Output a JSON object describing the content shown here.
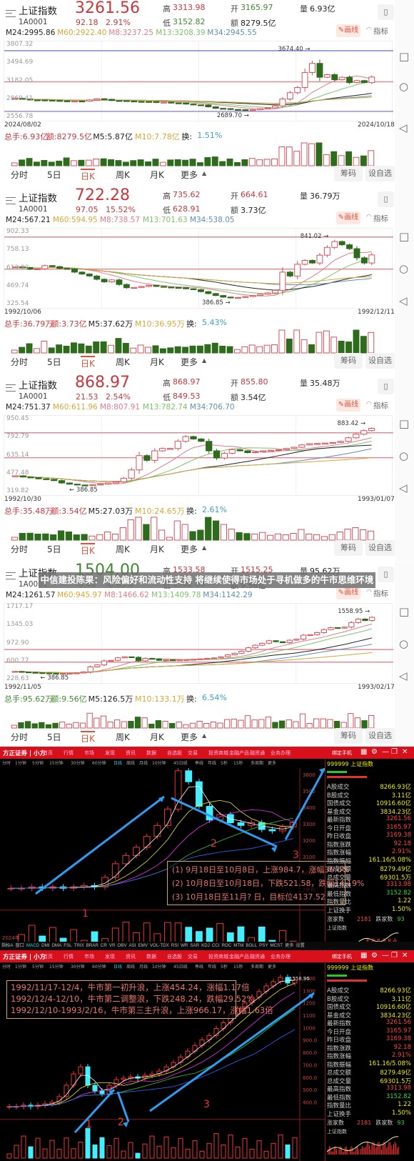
{
  "panels": [
    {
      "name": "上证指数",
      "code": "1A0001",
      "price": "3261.56",
      "change": "92.18",
      "change_pct": "2.91%",
      "price_color": "#c8373b",
      "high_label": "高",
      "high": "3313.98",
      "low_label": "低",
      "low": "3152.82",
      "open_label": "开",
      "open": "3165.97",
      "amount_label": "额",
      "amount": "8279.5亿",
      "vol_label": "量",
      "vol": "6.93亿",
      "ma": [
        "M24:2995.86",
        "M60:2922.40",
        "M8:3237.25",
        "M13:3208.39",
        "M34:2945.55"
      ],
      "axis": [
        "3807.32",
        "3494.69",
        "3182.05",
        "2869.41",
        "2556.78"
      ],
      "ylim": [
        2556.78,
        3807.32
      ],
      "date_start": "2024/08/02",
      "date_end": "2024/10/18",
      "vol_stats": [
        "总手:6.93亿",
        "额:8279.5亿",
        "M5:5.87亿",
        "M10:7.78亿",
        "换:",
        "1.51%"
      ],
      "high_mark": "3674.40",
      "low_mark": "2689.70",
      "high_val": 3674.4,
      "low_val": 2689.7,
      "hlines": [
        {
          "v": 3700,
          "c": "#7b86d6"
        },
        {
          "v": 3182,
          "c": "#e08a95"
        },
        {
          "v": 2689,
          "c": "#9b8ed6"
        }
      ],
      "closes": [
        2905,
        2893,
        2880,
        2879,
        2876,
        2870,
        2867,
        2850,
        2862,
        2858,
        2880,
        2900,
        2890,
        2870,
        2868,
        2862,
        2855,
        2853,
        2850,
        2837,
        2842,
        2830,
        2827,
        2811,
        2798,
        2796,
        2765,
        2740,
        2735,
        2721,
        2718,
        2704,
        2717,
        2736,
        2748,
        2780,
        2896,
        3000,
        3087,
        3336,
        3489,
        3258,
        3301,
        3217,
        3258,
        3169,
        3202,
        3169,
        3261
      ]
    },
    {
      "name": "上证指数",
      "code": "1A0001",
      "price": "722.28",
      "change": "97.05",
      "change_pct": "15.52%",
      "price_color": "#c8373b",
      "high_label": "高",
      "high": "735.62",
      "low_label": "低",
      "low": "628.91",
      "open_label": "开",
      "open": "664.61",
      "amount_label": "额",
      "amount": "3.73亿",
      "vol_label": "量",
      "vol": "36.79万",
      "ma": [
        "M24:567.21",
        "M60:594.95",
        "M8:738.57",
        "M13:701.63",
        "M34:538.05"
      ],
      "axis": [
        "902.33",
        "758.13",
        "613.93",
        "469.74",
        "325.54"
      ],
      "ylim": [
        325.54,
        902.33
      ],
      "date_start": "1992/10/06",
      "date_end": "1992/12/11",
      "vol_stats": [
        "总手:36.79万",
        "额:3.73亿",
        "M5:37.62万",
        "M10:36.95万",
        "换:",
        "5.43%"
      ],
      "high_mark": "841.02",
      "low_mark": "386.85",
      "high_val": 841.02,
      "low_val": 386.85,
      "hlines": [
        {
          "v": 860,
          "c": "#e08a95"
        },
        {
          "v": 613,
          "c": "#e08a95"
        }
      ],
      "closes": [
        630,
        625,
        612,
        615,
        640,
        632,
        618,
        614,
        590,
        575,
        560,
        535,
        515,
        530,
        495,
        470,
        472,
        480,
        488,
        480,
        475,
        472,
        470,
        462,
        455,
        440,
        425,
        410,
        398,
        393,
        395,
        402,
        410,
        420,
        430,
        450,
        590,
        560,
        650,
        680,
        660,
        720,
        780,
        825,
        800,
        770,
        700,
        660,
        722
      ]
    },
    {
      "name": "上证指数",
      "code": "1A0001",
      "price": "868.97",
      "change": "21.53",
      "change_pct": "2.54%",
      "price_color": "#c8373b",
      "high_label": "高",
      "high": "868.97",
      "low_label": "低",
      "low": "849.53",
      "open_label": "开",
      "open": "855.80",
      "amount_label": "额",
      "amount": "3.54亿",
      "vol_label": "量",
      "vol": "35.48万",
      "ma": [
        "M24:751.37",
        "M60:611.96",
        "M8:807.91",
        "M13:782.74",
        "M34:706.70"
      ],
      "axis": [
        "950.45",
        "792.79",
        "635.14",
        "477.48",
        "319.82"
      ],
      "ylim": [
        319.82,
        950.45
      ],
      "date_start": "1992/10/30",
      "date_end": "1993/01/07",
      "vol_stats": [
        "总手:35.48万",
        "额:3.54亿",
        "M5:27.03万",
        "M10:24.65万",
        "换:",
        "2.61%"
      ],
      "high_mark": "883.42",
      "low_mark": "386.85",
      "high_val": 883.42,
      "low_val": 386.85,
      "hlines": [
        {
          "v": 832,
          "c": "#e08a95"
        },
        {
          "v": 622,
          "c": "#e08a95"
        }
      ],
      "closes": [
        470,
        460,
        455,
        445,
        440,
        430,
        410,
        400,
        393,
        390,
        395,
        400,
        410,
        420,
        450,
        520,
        640,
        600,
        680,
        700,
        700,
        760,
        800,
        780,
        760,
        680,
        620,
        660,
        690,
        680,
        665,
        672,
        680,
        685,
        690,
        700,
        710,
        730,
        740,
        742,
        745,
        750,
        760,
        790,
        820,
        850,
        869
      ]
    },
    {
      "name": "上证指数",
      "code": "1A0001",
      "price": "1504.00",
      "change": "-9.48",
      "change_pct": "-0.63%",
      "price_color": "#3e8a2e",
      "high_label": "高",
      "high": "1533.58",
      "low_label": "低",
      "low": "1502.88",
      "open_label": "开",
      "open": "1515.25",
      "amount_label": "额",
      "amount": "9.56亿",
      "vol_label": "量",
      "vol": "95.62万",
      "ma": [
        "M24:1261.57",
        "M60:945.97",
        "M8:1466.62",
        "M13:1409.78",
        "M34:1142.29"
      ],
      "axis": [
        "1717.17",
        "1345.03",
        "972.90",
        "600.77",
        "228.63"
      ],
      "ylim": [
        228.63,
        1717.17
      ],
      "date_start": "1992/11/05",
      "date_end": "1993/02/17",
      "vol_stats": [
        "总手:95.62万",
        "额:9.56亿",
        "M5:126.5万",
        "M10:133.1万",
        "换:",
        "6.54%"
      ],
      "high_mark": "1558.95",
      "low_mark": "386.85",
      "high_val": 1558.95,
      "low_val": 386.85,
      "hlines": [
        {
          "v": 865,
          "c": "#e08a95"
        },
        {
          "v": 615,
          "c": "#e08a95"
        }
      ],
      "closes": [
        430,
        420,
        412,
        405,
        400,
        395,
        390,
        392,
        395,
        400,
        420,
        520,
        560,
        640,
        650,
        700,
        720,
        710,
        640,
        690,
        680,
        650,
        660,
        650,
        660,
        665,
        670,
        680,
        690,
        700,
        720,
        760,
        790,
        830,
        900,
        950,
        990,
        1040,
        1020,
        1000,
        1050,
        1070,
        1150,
        1160,
        1200,
        1260,
        1300,
        1290,
        1310,
        1400,
        1470,
        1440,
        1504
      ]
    }
  ],
  "tabs": [
    "分时",
    "5日",
    "日K",
    "周K",
    "月K",
    "更多"
  ],
  "active_tab": "日K",
  "chips_button": "筹码",
  "watchlist_button": "设自选",
  "draw_button": "画线",
  "indicator_button": "指标",
  "colors": {
    "up": "#c8373b",
    "down": "#2e6b1c",
    "ma24": "#222",
    "ma60": "#d8a634",
    "ma8": "#e07c8b",
    "ma13": "#7cc36a",
    "ma34": "#5b8fb5",
    "accent": "#d9533a"
  },
  "banner": "中信建投陈果：风险偏好和流动性支持 将继续使得市场处于寻机做多的牛市思维环境",
  "desktop": {
    "brand": "方正证券 | 小方",
    "menu": [
      "首页",
      "行情",
      "市场",
      "发现",
      "资讯",
      "数据",
      "自选股",
      "交易",
      "投资商城",
      "金融产品",
      "融资通",
      "业务办理"
    ],
    "window_label": "绑定手机",
    "period_bar": [
      "分时",
      "1分钟",
      "5分钟",
      "15分钟",
      "30分钟",
      "60分钟",
      "日线",
      "周线",
      "月线",
      "10分钟",
      "45日线",
      "季线",
      "年线",
      "5秒",
      "15秒",
      "多周期",
      "更多"
    ],
    "indicator_bar": [
      "指标A",
      "窗口",
      "MACD",
      "DMI",
      "DMA",
      "FSL",
      "TRIX",
      "BRAR",
      "CR",
      "VR",
      "OBV",
      "ASI",
      "EMV",
      "VOL-TDX",
      "RSI",
      "WR",
      "SAR",
      "KDJ",
      "CCI",
      "ROC",
      "MTM",
      "BOLL",
      "PSY",
      "MCST",
      "更多",
      "设置"
    ],
    "quote_title": "999999 上证指数",
    "info": [
      [
        "A股成交",
        "8266.93亿"
      ],
      [
        "B股成交",
        "3.11亿"
      ],
      [
        "国债成交",
        "10916.60亿"
      ],
      [
        "基金成交",
        "3834.23亿"
      ],
      [
        "最新指数",
        "3261.56"
      ],
      [
        "今日开盘",
        "3165.97"
      ],
      [
        "昨日收盘",
        "3169.38"
      ],
      [
        "指数涨跌",
        "92.18"
      ],
      [
        "指数涨幅",
        "2.91%"
      ],
      [
        "指数振幅",
        "161.16/5.08%"
      ],
      [
        "总成交额",
        "8279.49亿"
      ],
      [
        "总成交量",
        "69301.5万"
      ],
      [
        "最高指数",
        "3313.98"
      ],
      [
        "最低指数",
        "3152.82"
      ],
      [
        "指数量比",
        "1.22"
      ],
      [
        "上证换手",
        "1.50%"
      ]
    ],
    "up_count_label": "涨家数",
    "up_count": "2181",
    "down_count_label": "跌家数",
    "down_count": "93",
    "mini_title": "上证指数",
    "chart1": {
      "wave_labels": [
        "1",
        "2",
        "3"
      ],
      "notes": [
        "(1) 9月18日至10月8日，上涨984.7，涨幅36.6%",
        "(2) 10月8日至10月18日，下跌521.58，跌幅14.19%",
        "(3) 10月18日至11月? 日，目标位4137.52"
      ],
      "axis": [
        "3600",
        "3500",
        "3400",
        "3300",
        "3200",
        "3100",
        "3000",
        "2900"
      ],
      "low_mark": "2689.70",
      "year": "2024年"
    },
    "chart2": {
      "wave_labels": [
        "1",
        "2",
        "3"
      ],
      "notes": [
        "1992/11/17-12/4，牛市第一初升浪，上涨454.24，涨幅1.17倍",
        "1992/12/4-12/10，牛市第二调整浪，下跌248.24，跌幅29.52%",
        "1992/12/10-1993/2/16，牛市第三主升浪，上涨966.17，涨幅1.63倍"
      ],
      "axis": [
        "1400",
        "1300",
        "1200",
        "1100",
        "1000",
        "900.0",
        "800.0",
        "700.0",
        "600.0",
        "500.0",
        "400.0"
      ],
      "high_mark": "1558.95"
    }
  }
}
